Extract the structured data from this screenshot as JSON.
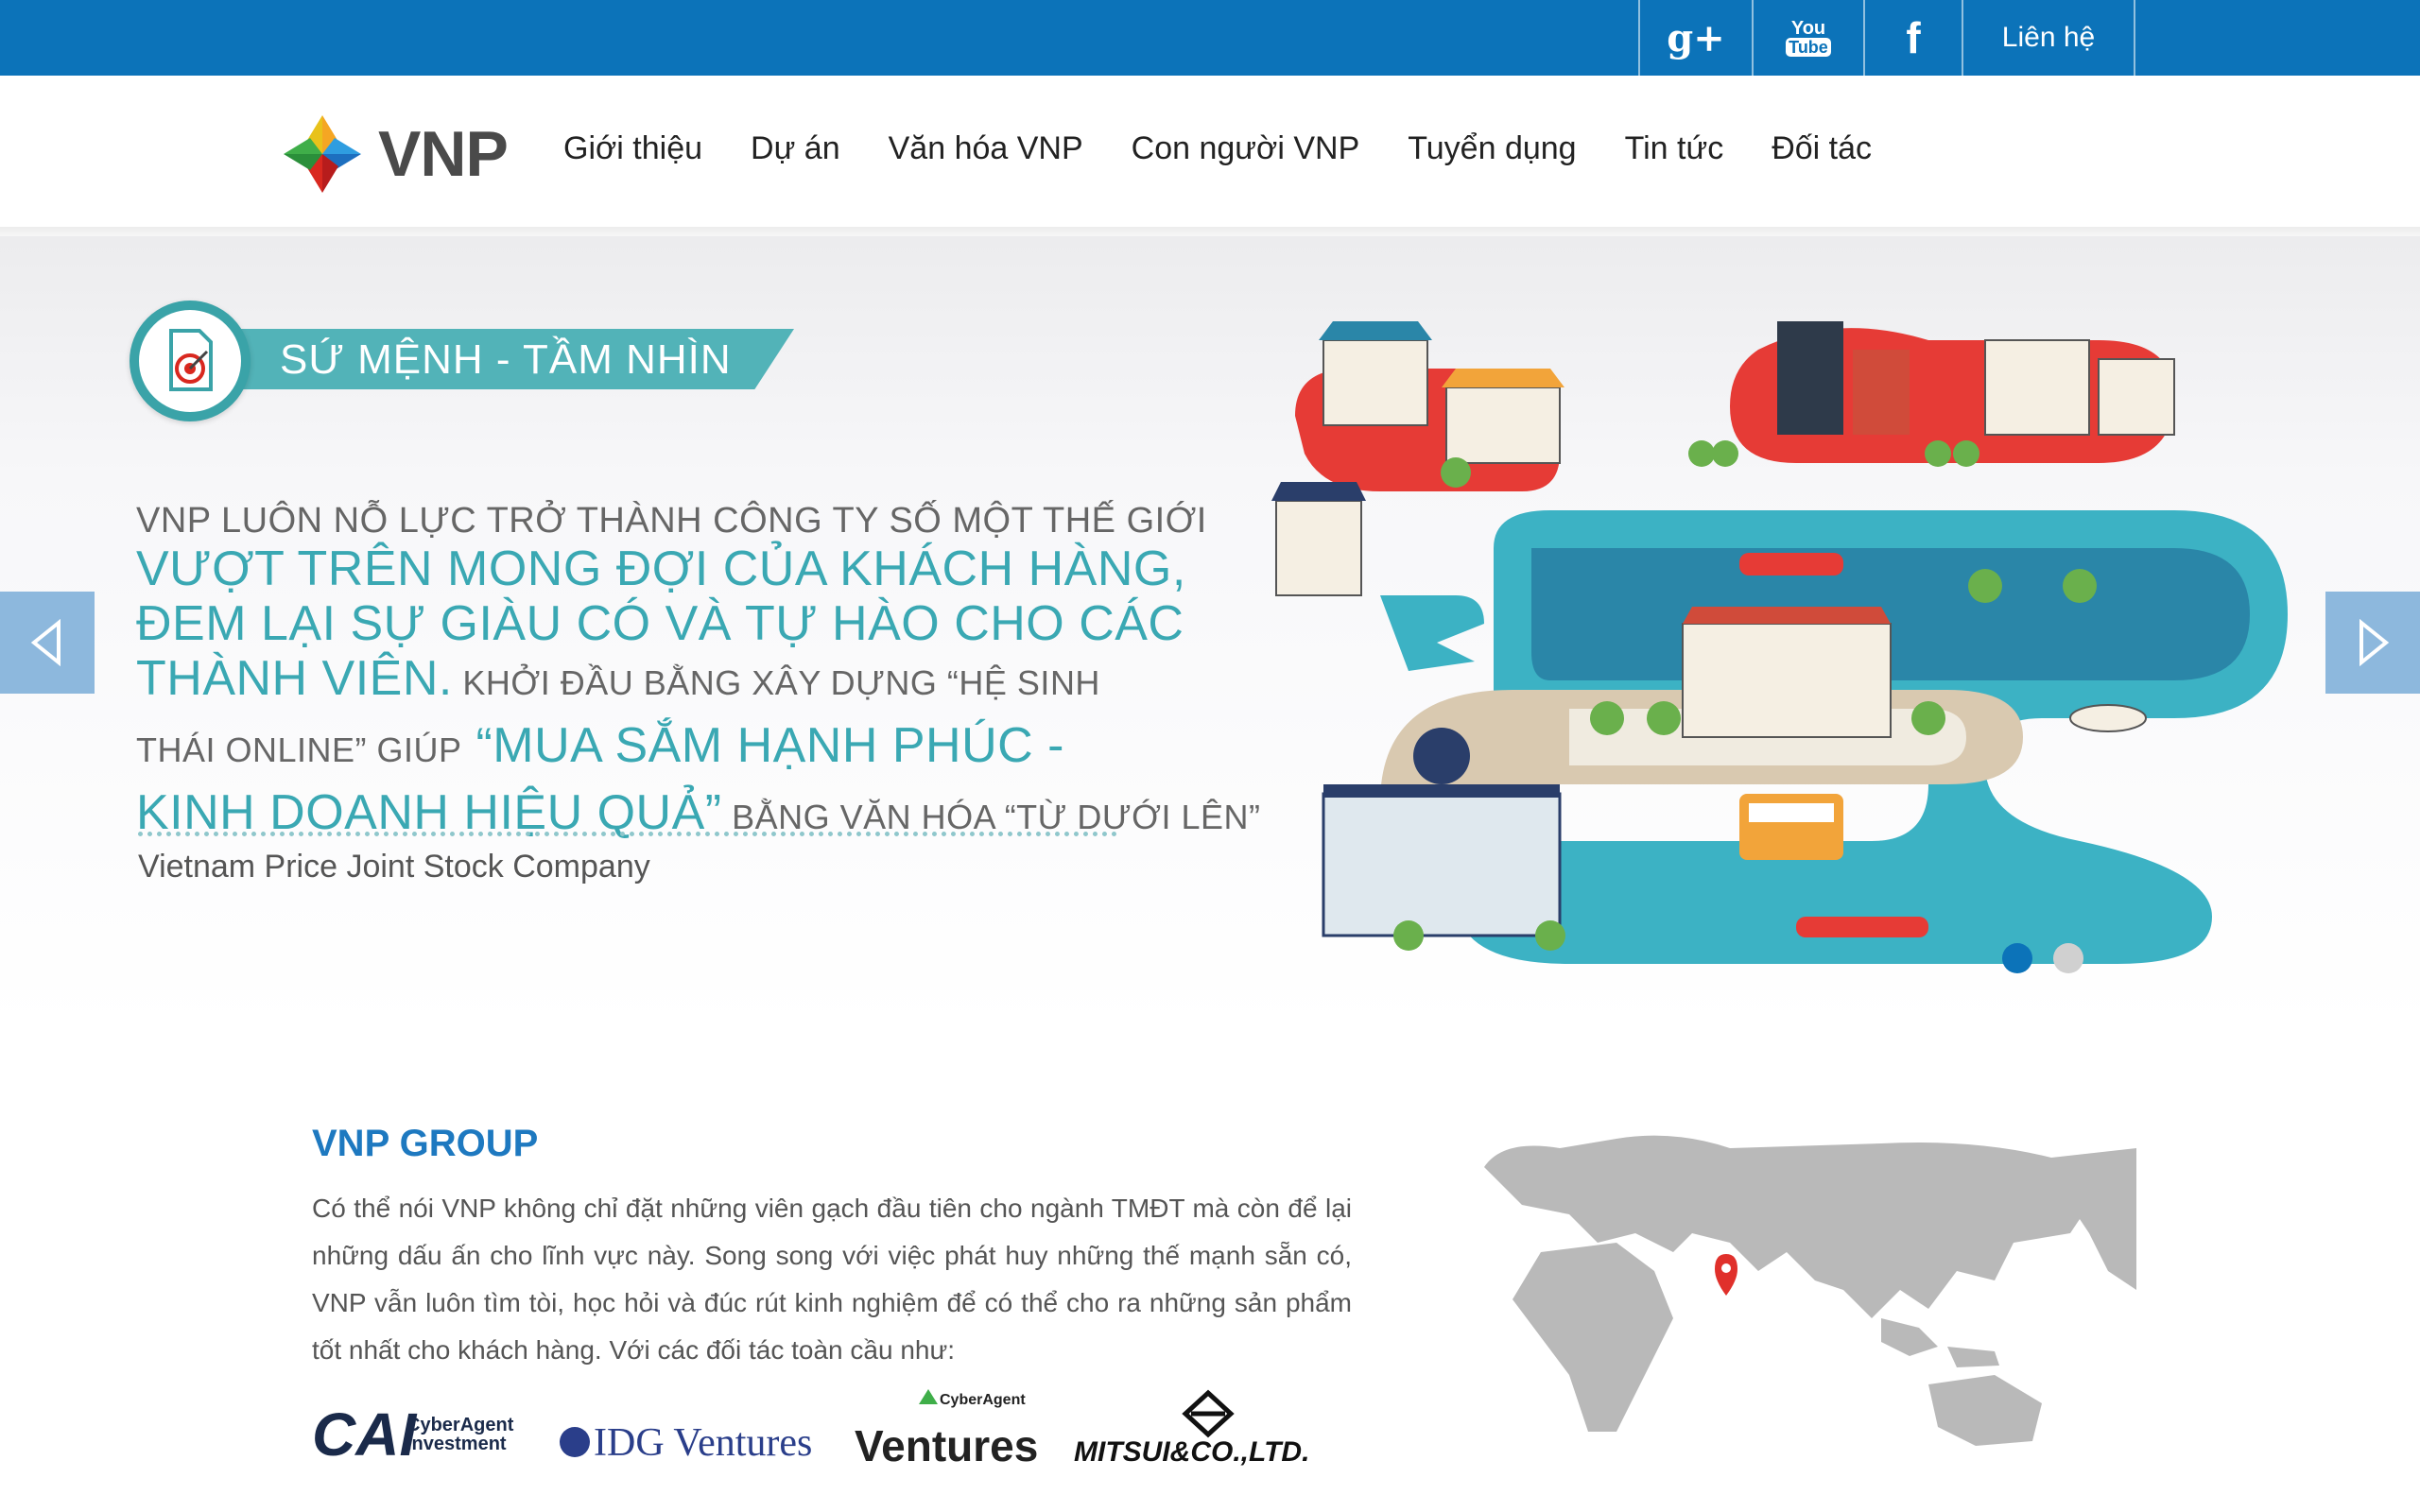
{
  "topbar": {
    "social": [
      {
        "name": "google-plus",
        "label": "g+"
      },
      {
        "name": "youtube",
        "label_top": "You",
        "label_bottom": "Tube"
      },
      {
        "name": "facebook",
        "label": "f"
      }
    ],
    "contact_label": "Liên hệ"
  },
  "header": {
    "logo_text": "VNP",
    "nav": [
      "Giới thiệu",
      "Dự án",
      "Văn hóa VNP",
      "Con người VNP",
      "Tuyển dụng",
      "Tin tức",
      "Đối tác"
    ]
  },
  "slider": {
    "badge_label": "SỨ MỆNH  - TẦM NHÌN",
    "line1": "VNP LUÔN NỖ LỰC TRỞ THÀNH CÔNG TY SỐ MỘT THẾ GIỚI",
    "line2": "VƯỢT TRÊN MONG ĐỢI CỦA KHÁCH HÀNG,",
    "line3": "ĐEM LẠI SỰ GIÀU CÓ VÀ TỰ HÀO CHO CÁC",
    "line4_big": "THÀNH VIÊN.",
    "line4_small": " KHỞI ĐẦU BẰNG XÂY DỰNG “HỆ SINH",
    "line5_small": "THÁI ONLINE” GIÚP",
    "line5_big": "  “MUA SẮM HẠNH PHÚC -",
    "line6_big": "KINH DOANH HIỆU QUẢ”",
    "line6_small": " BẰNG VĂN HÓA “TỪ DƯỚI LÊN”",
    "company": "Vietnam Price Joint Stock Company",
    "slide_count": 2,
    "active_slide": 1
  },
  "about": {
    "title": "VNP GROUP",
    "text": "Có thể nói VNP không chỉ đặt những viên gạch đầu tiên cho ngành TMĐT mà còn để lại những dấu ấn cho lĩnh vực này. Song song với việc phát huy những thế mạnh sẵn có, VNP vẫn luôn tìm tòi, học hỏi và đúc rút kinh nghiệm để có thể cho ra những sản phẩm tốt nhất cho khách hàng. Với các đối tác toàn cầu như:",
    "partners": [
      {
        "logo_main": "CAI",
        "logo_sub1": "CyberAgent",
        "logo_sub2": "Investment"
      },
      {
        "logo_main": "IDG Ventures"
      },
      {
        "logo_top": "CyberAgent",
        "logo_main": "Ventures"
      },
      {
        "logo_main": "MITSUI&CO.,LTD."
      }
    ]
  },
  "colors": {
    "topbar": "#0c73b9",
    "teal": "#3aa8b3",
    "title_blue": "#1e79c0",
    "arrow_bg": "#8db8dd"
  }
}
